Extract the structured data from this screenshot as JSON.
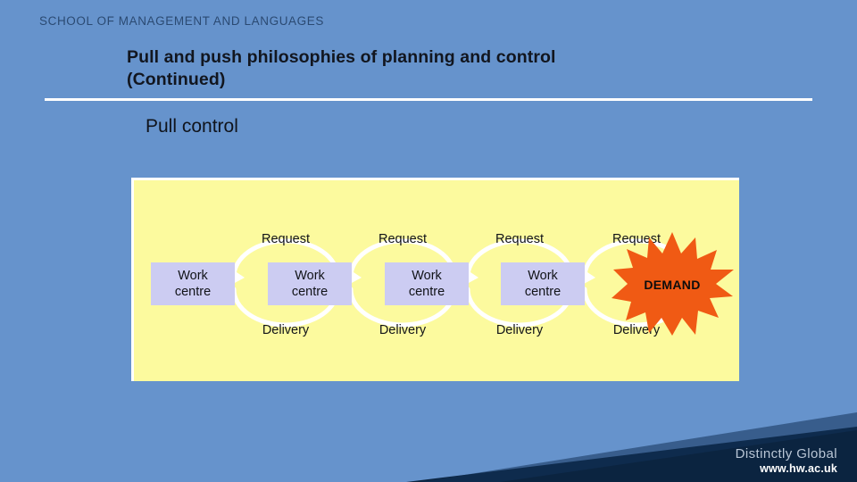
{
  "slide": {
    "school_label": "SCHOOL OF MANAGEMENT AND LANGUAGES",
    "title_line1": "Pull and push philosophies of planning and control",
    "title_line2": "(Continued)",
    "section_heading": "Pull control"
  },
  "diagram": {
    "work_centres": [
      {
        "line1": "Work",
        "line2": "centre"
      },
      {
        "line1": "Work",
        "line2": "centre"
      },
      {
        "line1": "Work",
        "line2": "centre"
      },
      {
        "line1": "Work",
        "line2": "centre"
      }
    ],
    "request_labels": [
      "Request",
      "Request",
      "Request",
      "Request"
    ],
    "delivery_labels": [
      "Delivery",
      "Delivery",
      "Delivery",
      "Delivery"
    ],
    "demand_label": "DEMAND"
  },
  "brand": {
    "tagline": "Distinctly Global",
    "url": "www.hw.ac.uk"
  },
  "colors": {
    "background": "#6693cc",
    "panel": "#fcfa9e",
    "work_centre": "#ccccf2",
    "demand": "#f05a14",
    "footer_band": "#0b2440",
    "rule": "#ffffff",
    "school_text": "#2b4a72"
  }
}
